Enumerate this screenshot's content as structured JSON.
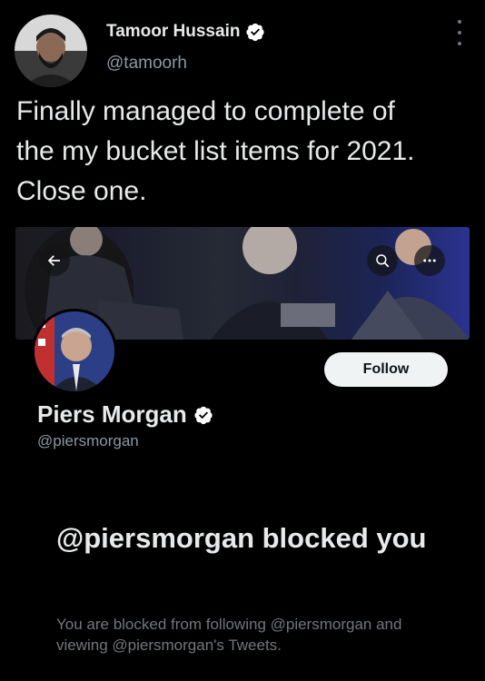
{
  "tweet": {
    "author_name": "Tamoor Hussain",
    "author_handle": "@tamoorh",
    "text": "Finally managed to complete of\nthe my bucket list items for 2021.\nClose one."
  },
  "profile_card": {
    "name": "Piers Morgan",
    "handle": "@piersmorgan",
    "follow_label": "Follow",
    "blocked_title": "@piersmorgan blocked you",
    "blocked_description": "You are blocked from following @piersmorgan and viewing @piersmorgan's Tweets."
  },
  "icons": {
    "verified": "verified-badge-icon",
    "back": "back-arrow-icon",
    "search": "search-icon",
    "more": "more-horizontal-icon",
    "options": "more-vertical-icon"
  },
  "colors": {
    "background": "#000000",
    "primary_text": "#e7e9ea",
    "secondary_text": "#8b98a5",
    "muted_text": "#71767b",
    "follow_bg": "#eff3f4"
  }
}
